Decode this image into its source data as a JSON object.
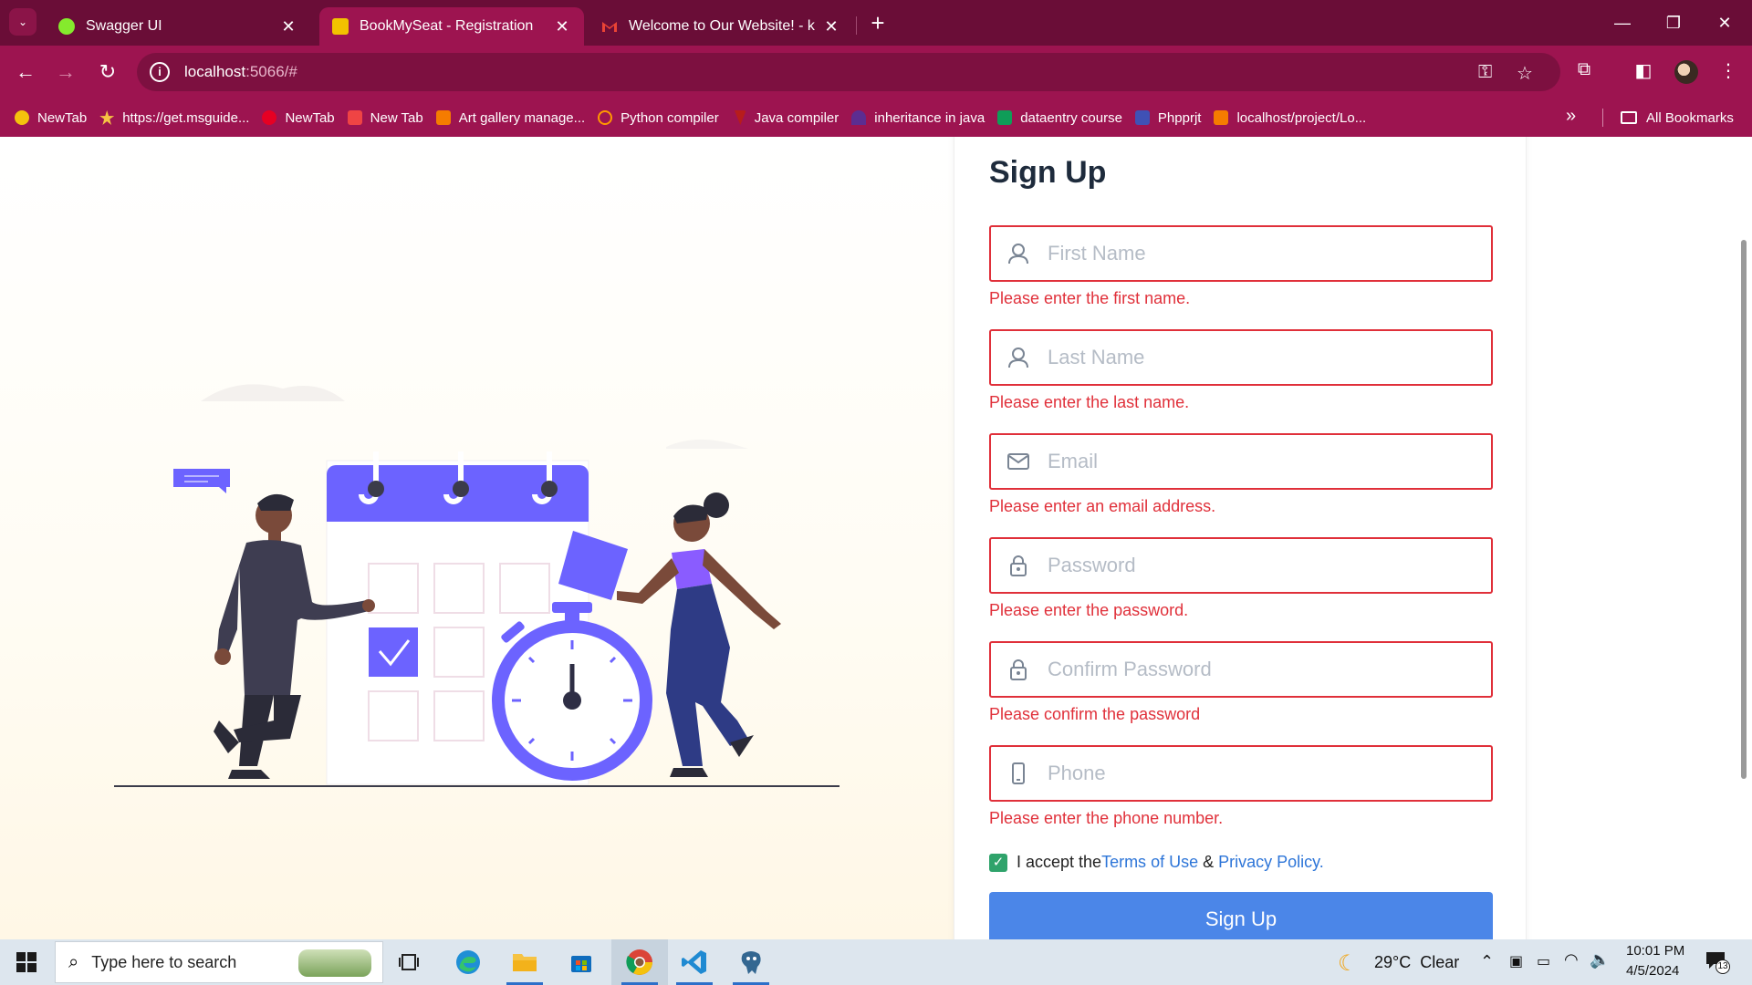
{
  "browser": {
    "tabs": [
      {
        "title": "Swagger UI",
        "favicon_color": "#85ea2d",
        "active": false
      },
      {
        "title": "BookMySeat - Registration",
        "favicon_color": "#f2c200",
        "active": true
      },
      {
        "title": "Welcome to Our Website! - kon",
        "favicon_color": "#ea4335",
        "active": false
      }
    ],
    "close_glyph": "✕",
    "new_tab_glyph": "+",
    "url_host": "localhost",
    "url_rest": ":5066/#",
    "window_controls": {
      "minimize": "—",
      "restore": "❐",
      "close": "✕"
    }
  },
  "bookmarks": [
    {
      "label": "NewTab",
      "color": "#f4c20d"
    },
    {
      "label": "https://get.msguide...",
      "color": "#f6c343"
    },
    {
      "label": "NewTab",
      "color": "#e60023"
    },
    {
      "label": "New Tab",
      "color": "#ef4444"
    },
    {
      "label": "Art gallery manage...",
      "color": "#f57c00"
    },
    {
      "label": "Python compiler",
      "color": "#ff9800"
    },
    {
      "label": "Java compiler",
      "color": "#b71c1c"
    },
    {
      "label": "inheritance in java",
      "color": "#5c2d91"
    },
    {
      "label": "dataentry course",
      "color": "#0f9d58"
    },
    {
      "label": "Phpprjt",
      "color": "#3f51b5"
    },
    {
      "label": "localhost/project/Lo...",
      "color": "#f57c00"
    }
  ],
  "all_bookmarks": "All Bookmarks",
  "form": {
    "title": "Sign Up",
    "fields": [
      {
        "placeholder": "First Name",
        "icon": "user-icon",
        "error": "Please enter the first name."
      },
      {
        "placeholder": "Last Name",
        "icon": "user-icon",
        "error": "Please enter the last name."
      },
      {
        "placeholder": "Email",
        "icon": "mail-icon",
        "error": "Please enter an email address."
      },
      {
        "placeholder": "Password",
        "icon": "lock-icon",
        "error": "Please enter the password."
      },
      {
        "placeholder": "Confirm Password",
        "icon": "lock-icon",
        "error": "Please confirm the password"
      },
      {
        "placeholder": "Phone",
        "icon": "phone-icon",
        "error": "Please enter the phone number."
      }
    ],
    "accept_prefix": "I accept the",
    "terms": "Terms of Use",
    "amp": " & ",
    "privacy": "Privacy Policy.",
    "submit": "Sign Up",
    "accent": "#4b86e8",
    "error_color": "#e0303a"
  },
  "taskbar": {
    "search_placeholder": "Type here to search",
    "weather": "29°C  Clear",
    "time": "10:01 PM",
    "date": "4/5/2024",
    "notifications": "13"
  }
}
